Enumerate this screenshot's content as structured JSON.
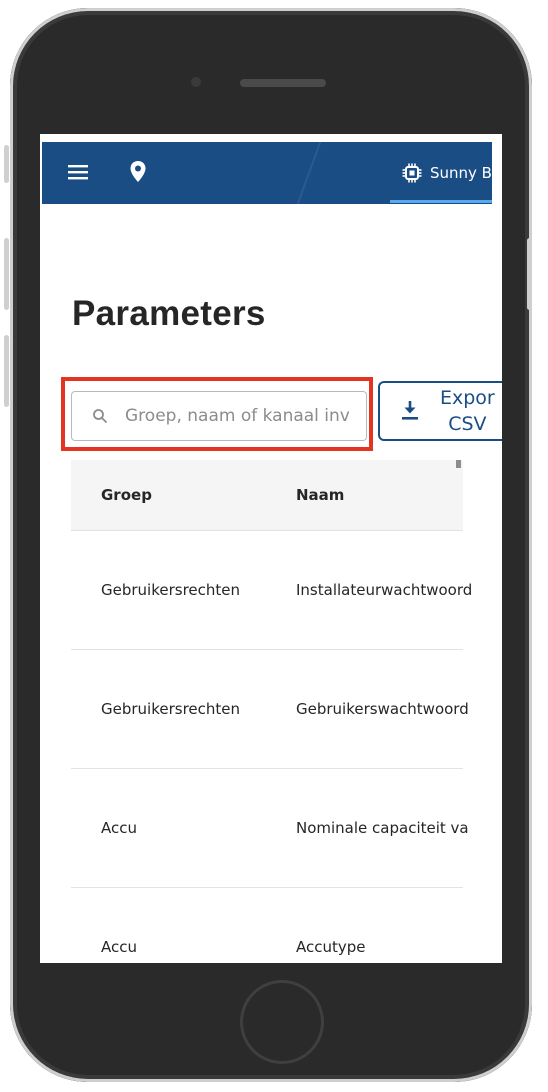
{
  "header": {
    "device_name": "Sunny Bo"
  },
  "page": {
    "title": "Parameters"
  },
  "search": {
    "placeholder": "Groep, naam of kanaal inv"
  },
  "export_button": {
    "line1": "Expor",
    "line2": "CSV"
  },
  "table": {
    "columns": [
      "Groep",
      "Naam"
    ],
    "rows": [
      [
        "Gebruikersrechten",
        "Installateurwachtwoord"
      ],
      [
        "Gebruikersrechten",
        "Gebruikerswachtwoord"
      ],
      [
        "Accu",
        "Nominale capaciteit va"
      ],
      [
        "Accu",
        "Accutype"
      ]
    ]
  },
  "colors": {
    "primary": "#1b4d85",
    "highlight": "#e53322"
  }
}
